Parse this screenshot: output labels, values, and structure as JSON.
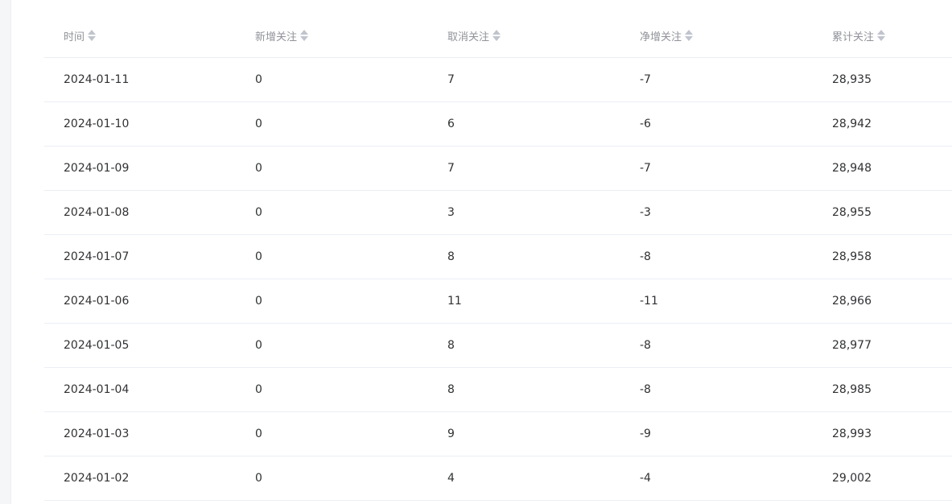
{
  "table": {
    "columns": [
      {
        "key": "date",
        "label": "时间",
        "sort_icon": "sort-caret-icon"
      },
      {
        "key": "new_follow",
        "label": "新增关注",
        "sort_icon": "sort-caret-icon"
      },
      {
        "key": "unfollow",
        "label": "取消关注",
        "sort_icon": "sort-caret-icon"
      },
      {
        "key": "net_follow",
        "label": "净增关注",
        "sort_icon": "sort-caret-icon"
      },
      {
        "key": "total_follow",
        "label": "累计关注",
        "sort_icon": "sort-caret-icon"
      }
    ],
    "rows": [
      [
        "2024-01-11",
        "0",
        "7",
        "-7",
        "28,935"
      ],
      [
        "2024-01-10",
        "0",
        "6",
        "-6",
        "28,942"
      ],
      [
        "2024-01-09",
        "0",
        "7",
        "-7",
        "28,948"
      ],
      [
        "2024-01-08",
        "0",
        "3",
        "-3",
        "28,955"
      ],
      [
        "2024-01-07",
        "0",
        "8",
        "-8",
        "28,958"
      ],
      [
        "2024-01-06",
        "0",
        "11",
        "-11",
        "28,966"
      ],
      [
        "2024-01-05",
        "0",
        "8",
        "-8",
        "28,977"
      ],
      [
        "2024-01-04",
        "0",
        "8",
        "-8",
        "28,985"
      ],
      [
        "2024-01-03",
        "0",
        "9",
        "-9",
        "28,993"
      ],
      [
        "2024-01-02",
        "0",
        "4",
        "-4",
        "29,002"
      ]
    ]
  },
  "colors": {
    "header_text": "#909399",
    "cell_text": "#303133",
    "row_border": "#ebeef5",
    "sort_icon": "#c0c4cc"
  }
}
